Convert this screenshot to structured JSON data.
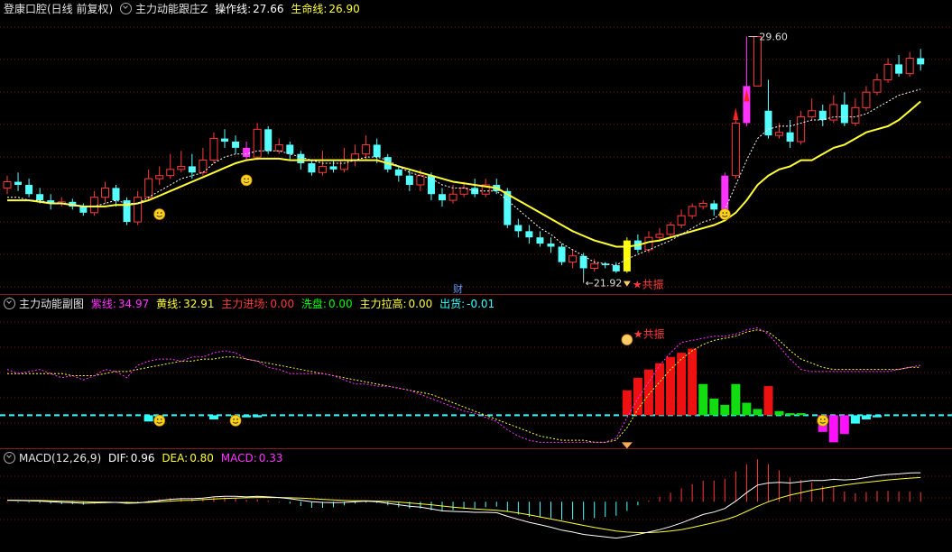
{
  "colors": {
    "bg": "#000000",
    "grid": "#7a1010",
    "up": "#ff3a3a",
    "down": "#55ffff",
    "yellow": "#ffff33",
    "white": "#ffffff",
    "magenta": "#ff33ff",
    "green": "#00ff00",
    "cyan": "#33ffff"
  },
  "panel1": {
    "title": "登康口腔(日线 前复权)",
    "indicator": "主力动能跟庄Z",
    "op_label": "操作线:",
    "op_value": "27.66",
    "life_label": "生命线:",
    "life_value": "26.90",
    "high_label": "29.60",
    "low_label": "21.92",
    "resonance_label": "★共振",
    "cai_label": "财"
  },
  "panel2": {
    "title": "主力动能副图",
    "purple_label": "紫线:",
    "purple_value": "34.97",
    "yellow_label": "黄线:",
    "yellow_value": "32.91",
    "enter_label": "主力进场:",
    "enter_value": "0.00",
    "wash_label": "洗盘:",
    "wash_value": "0.00",
    "pull_label": "主力拉高:",
    "pull_value": "0.00",
    "exit_label": "出货:",
    "exit_value": "-0.01",
    "resonance_label": "★共振"
  },
  "panel3": {
    "title": "MACD(12,26,9)",
    "dif_label": "DIF:",
    "dif_value": "0.96",
    "dea_label": "DEA:",
    "dea_value": "0.80",
    "macd_label": "MACD:",
    "macd_value": "0.33"
  },
  "chart_data": [
    {
      "type": "candlestick",
      "ylim": [
        21.5,
        30.2
      ],
      "candles": [
        [
          24.7,
          24.9,
          25.1,
          24.5
        ],
        [
          24.9,
          24.8,
          25.2,
          24.6
        ],
        [
          24.8,
          24.5,
          25.0,
          24.4
        ],
        [
          24.5,
          24.3,
          24.7,
          24.2
        ],
        [
          24.3,
          24.2,
          24.5,
          24.0
        ],
        [
          24.2,
          24.25,
          24.4,
          24.1
        ],
        [
          24.25,
          24.1,
          24.35,
          24.0
        ],
        [
          24.1,
          23.9,
          24.2,
          23.8
        ],
        [
          23.9,
          24.4,
          24.6,
          23.8
        ],
        [
          24.4,
          24.7,
          24.9,
          24.2
        ],
        [
          24.7,
          24.3,
          24.8,
          24.1
        ],
        [
          24.3,
          23.6,
          24.4,
          23.5
        ],
        [
          23.6,
          24.4,
          24.6,
          23.5
        ],
        [
          24.4,
          25.0,
          25.3,
          24.3
        ],
        [
          25.0,
          25.1,
          25.4,
          24.8
        ],
        [
          25.1,
          25.3,
          25.8,
          25.0
        ],
        [
          25.3,
          25.4,
          25.9,
          25.2
        ],
        [
          25.4,
          25.2,
          25.8,
          25.0
        ],
        [
          25.2,
          25.6,
          26.0,
          25.1
        ],
        [
          25.6,
          26.3,
          26.5,
          25.5
        ],
        [
          26.3,
          26.2,
          26.6,
          26.0
        ],
        [
          26.2,
          26.0,
          26.4,
          25.8
        ],
        [
          26.0,
          25.7,
          26.2,
          25.6
        ],
        [
          25.7,
          26.6,
          26.8,
          25.6
        ],
        [
          26.6,
          25.9,
          26.7,
          25.8
        ],
        [
          25.9,
          26.1,
          26.3,
          25.8
        ],
        [
          26.1,
          25.8,
          26.2,
          25.6
        ],
        [
          25.8,
          25.5,
          25.9,
          25.3
        ],
        [
          25.5,
          25.2,
          25.6,
          25.1
        ],
        [
          25.2,
          25.4,
          25.9,
          25.1
        ],
        [
          25.4,
          25.3,
          25.6,
          25.2
        ],
        [
          25.3,
          25.6,
          26.0,
          25.2
        ],
        [
          25.6,
          25.8,
          26.1,
          25.4
        ],
        [
          25.8,
          26.1,
          26.4,
          25.6
        ],
        [
          26.1,
          25.7,
          26.3,
          25.5
        ],
        [
          25.7,
          25.3,
          25.8,
          25.2
        ],
        [
          25.3,
          25.1,
          25.4,
          24.9
        ],
        [
          25.1,
          24.8,
          25.3,
          24.6
        ],
        [
          24.8,
          25.1,
          25.3,
          24.6
        ],
        [
          25.1,
          24.5,
          25.2,
          24.3
        ],
        [
          24.5,
          24.3,
          24.7,
          24.1
        ],
        [
          24.3,
          24.5,
          24.8,
          24.2
        ],
        [
          24.5,
          24.7,
          24.9,
          24.4
        ],
        [
          24.7,
          24.5,
          25.0,
          24.4
        ],
        [
          24.5,
          24.8,
          25.0,
          24.4
        ],
        [
          24.8,
          24.6,
          25.0,
          24.5
        ],
        [
          24.6,
          23.5,
          24.7,
          23.4
        ],
        [
          23.5,
          23.3,
          23.7,
          23.1
        ],
        [
          23.3,
          23.1,
          23.5,
          22.9
        ],
        [
          23.1,
          22.9,
          23.3,
          22.8
        ],
        [
          22.9,
          22.8,
          23.1,
          22.6
        ],
        [
          22.8,
          22.3,
          22.9,
          22.2
        ],
        [
          22.3,
          22.5,
          22.7,
          22.1
        ],
        [
          22.5,
          22.1,
          22.6,
          21.92
        ],
        [
          22.1,
          22.25,
          22.4,
          22.0
        ],
        [
          22.25,
          22.2,
          22.3,
          22.1
        ],
        [
          22.2,
          22.0,
          22.3,
          21.95
        ],
        [
          22.0,
          23.0,
          23.1,
          21.95
        ],
        [
          23.0,
          22.7,
          23.2,
          22.6
        ],
        [
          22.7,
          23.1,
          23.3,
          22.6
        ],
        [
          23.1,
          23.2,
          23.4,
          23.0
        ],
        [
          23.2,
          23.5,
          23.6,
          23.1
        ],
        [
          23.5,
          23.8,
          24.0,
          23.4
        ],
        [
          23.8,
          24.1,
          24.2,
          23.7
        ],
        [
          24.1,
          24.2,
          24.3,
          24.0
        ],
        [
          24.2,
          24.0,
          24.3,
          23.8
        ],
        [
          24.0,
          25.1,
          25.2,
          23.9
        ],
        [
          25.1,
          26.8,
          27.0,
          25.0
        ],
        [
          26.8,
          28.0,
          29.6,
          26.7
        ],
        [
          28.0,
          29.6,
          29.6,
          28.0
        ],
        [
          27.2,
          26.4,
          28.2,
          26.3
        ],
        [
          26.4,
          26.5,
          26.8,
          26.3
        ],
        [
          26.5,
          26.2,
          26.9,
          26.0
        ],
        [
          26.2,
          27.0,
          27.2,
          26.1
        ],
        [
          27.0,
          27.2,
          27.6,
          26.9
        ],
        [
          27.2,
          26.9,
          27.4,
          26.7
        ],
        [
          26.9,
          27.4,
          27.7,
          26.8
        ],
        [
          27.4,
          26.8,
          27.8,
          26.7
        ],
        [
          26.8,
          27.3,
          27.6,
          26.7
        ],
        [
          27.3,
          27.8,
          28.0,
          27.2
        ],
        [
          27.8,
          28.2,
          28.4,
          27.7
        ],
        [
          28.2,
          28.7,
          28.9,
          28.1
        ],
        [
          28.7,
          28.4,
          29.0,
          28.3
        ],
        [
          28.4,
          28.9,
          29.1,
          28.3
        ],
        [
          28.9,
          28.7,
          29.2,
          28.5
        ]
      ],
      "op_line": [
        24.4,
        24.4,
        24.3,
        24.3,
        24.2,
        24.2,
        24.15,
        24.1,
        24.1,
        24.2,
        24.3,
        24.2,
        24.2,
        24.4,
        24.6,
        24.8,
        25.0,
        25.1,
        25.2,
        25.5,
        25.7,
        25.8,
        25.8,
        25.9,
        25.9,
        25.9,
        25.8,
        25.7,
        25.6,
        25.5,
        25.5,
        25.5,
        25.6,
        25.7,
        25.7,
        25.6,
        25.4,
        25.2,
        25.1,
        25.0,
        24.8,
        24.7,
        24.7,
        24.6,
        24.6,
        24.6,
        24.3,
        24.0,
        23.7,
        23.4,
        23.2,
        22.9,
        22.7,
        22.5,
        22.3,
        22.25,
        22.2,
        22.4,
        22.55,
        22.7,
        22.85,
        23.0,
        23.2,
        23.4,
        23.6,
        23.7,
        24.0,
        24.8,
        25.6,
        26.3,
        26.6,
        26.7,
        26.7,
        26.8,
        26.9,
        26.9,
        27.0,
        27.0,
        27.0,
        27.1,
        27.3,
        27.5,
        27.7,
        27.8,
        27.9
      ],
      "life_line": [
        24.3,
        24.3,
        24.3,
        24.25,
        24.2,
        24.2,
        24.15,
        24.1,
        24.1,
        24.1,
        24.15,
        24.15,
        24.2,
        24.3,
        24.45,
        24.6,
        24.75,
        24.9,
        25.05,
        25.2,
        25.35,
        25.5,
        25.6,
        25.65,
        25.65,
        25.65,
        25.6,
        25.6,
        25.6,
        25.6,
        25.6,
        25.6,
        25.6,
        25.6,
        25.6,
        25.5,
        25.4,
        25.3,
        25.2,
        25.1,
        25.0,
        24.9,
        24.85,
        24.8,
        24.75,
        24.7,
        24.5,
        24.3,
        24.1,
        23.9,
        23.7,
        23.5,
        23.3,
        23.15,
        23.0,
        22.9,
        22.8,
        22.8,
        22.85,
        22.95,
        23.0,
        23.1,
        23.2,
        23.3,
        23.4,
        23.5,
        23.65,
        23.9,
        24.3,
        24.8,
        25.1,
        25.3,
        25.4,
        25.6,
        25.6,
        25.8,
        26.0,
        26.1,
        26.3,
        26.5,
        26.6,
        26.7,
        26.9,
        27.2,
        27.5
      ]
    },
    {
      "type": "line+bar",
      "ylim": [
        -15,
        50
      ],
      "purple": [
        22,
        20,
        21,
        22,
        20,
        18,
        19,
        17,
        19,
        22,
        21,
        18,
        24,
        26,
        27,
        27,
        26,
        28,
        28,
        30,
        31,
        30,
        27,
        26,
        23,
        22,
        20,
        20,
        20,
        20,
        19,
        17,
        15,
        15,
        14,
        14,
        13,
        12,
        10,
        8,
        6,
        4,
        2,
        1,
        -1,
        -3,
        -7,
        -10,
        -12,
        -13,
        -13,
        -13,
        -13,
        -13,
        -13,
        -13,
        -11,
        -1,
        8,
        16,
        24,
        30,
        35,
        36,
        37,
        38,
        38,
        39,
        41,
        42,
        39,
        33,
        27,
        22,
        21,
        21,
        21,
        21,
        21,
        21,
        21,
        21,
        22,
        23,
        24
      ],
      "yellow": [
        20,
        20,
        20,
        20,
        20,
        20,
        19,
        19,
        19,
        20,
        21,
        21,
        22,
        23,
        24,
        25,
        26,
        26,
        27,
        27,
        28,
        28,
        27,
        26,
        25,
        24,
        23,
        22,
        21,
        20,
        19,
        18,
        17,
        16,
        15,
        14,
        13,
        12,
        11,
        10,
        8,
        6,
        4,
        2,
        0,
        -2,
        -4,
        -6,
        -8,
        -10,
        -11,
        -12,
        -12,
        -12,
        -13,
        -13,
        -12,
        -6,
        3,
        10,
        16,
        22,
        27,
        31,
        34,
        36,
        37,
        38,
        40,
        41,
        40,
        36,
        31,
        27,
        25,
        23,
        22,
        22,
        22,
        22,
        22,
        22,
        22,
        23,
        23
      ],
      "red_bars": [
        [
          57,
          12
        ],
        [
          58,
          18
        ],
        [
          59,
          22
        ],
        [
          60,
          25
        ],
        [
          61,
          28
        ],
        [
          62,
          30
        ],
        [
          63,
          32
        ],
        [
          70,
          14
        ]
      ],
      "green_bars": [
        [
          64,
          15
        ],
        [
          65,
          8
        ],
        [
          66,
          5
        ],
        [
          67,
          15
        ],
        [
          68,
          6
        ],
        [
          69,
          3
        ],
        [
          71,
          2
        ],
        [
          72,
          1
        ],
        [
          73,
          1
        ]
      ],
      "magenta_bars": [
        [
          75,
          -8
        ],
        [
          76,
          -13
        ],
        [
          77,
          -9
        ]
      ],
      "cyan_bars": [
        [
          13,
          -3
        ],
        [
          14,
          -2
        ],
        [
          19,
          -2
        ],
        [
          21,
          -2
        ],
        [
          22,
          -1
        ],
        [
          23,
          -1
        ],
        [
          78,
          -4
        ],
        [
          79,
          -2
        ],
        [
          80,
          -1
        ]
      ]
    },
    {
      "type": "line+bar",
      "ylim": [
        -1.6,
        1.2
      ],
      "dif": [
        0.05,
        0.04,
        0.03,
        0.02,
        0.0,
        -0.02,
        -0.03,
        -0.05,
        -0.04,
        -0.03,
        -0.02,
        -0.05,
        -0.04,
        0.0,
        0.04,
        0.08,
        0.1,
        0.1,
        0.12,
        0.16,
        0.18,
        0.18,
        0.16,
        0.18,
        0.16,
        0.14,
        0.1,
        0.05,
        0.0,
        -0.02,
        -0.03,
        -0.02,
        0.0,
        0.02,
        0.0,
        -0.05,
        -0.1,
        -0.15,
        -0.18,
        -0.24,
        -0.3,
        -0.32,
        -0.33,
        -0.35,
        -0.35,
        -0.36,
        -0.48,
        -0.58,
        -0.68,
        -0.76,
        -0.84,
        -0.94,
        -1.0,
        -1.08,
        -1.12,
        -1.16,
        -1.2,
        -1.15,
        -1.08,
        -1.0,
        -0.92,
        -0.82,
        -0.7,
        -0.56,
        -0.42,
        -0.34,
        -0.22,
        0.02,
        0.3,
        0.55,
        0.62,
        0.64,
        0.62,
        0.66,
        0.7,
        0.7,
        0.74,
        0.72,
        0.74,
        0.8,
        0.86,
        0.9,
        0.92,
        0.95,
        0.96
      ],
      "dea": [
        0.05,
        0.05,
        0.04,
        0.04,
        0.03,
        0.02,
        0.01,
        0.0,
        -0.01,
        -0.01,
        -0.02,
        -0.02,
        -0.03,
        -0.02,
        0.0,
        0.02,
        0.04,
        0.05,
        0.07,
        0.09,
        0.11,
        0.12,
        0.13,
        0.14,
        0.14,
        0.14,
        0.13,
        0.12,
        0.1,
        0.08,
        0.06,
        0.04,
        0.03,
        0.03,
        0.02,
        0.01,
        -0.01,
        -0.04,
        -0.07,
        -0.1,
        -0.14,
        -0.18,
        -0.21,
        -0.24,
        -0.26,
        -0.28,
        -0.32,
        -0.37,
        -0.43,
        -0.5,
        -0.57,
        -0.64,
        -0.71,
        -0.78,
        -0.85,
        -0.91,
        -0.97,
        -1.0,
        -1.02,
        -1.02,
        -1.0,
        -0.97,
        -0.92,
        -0.85,
        -0.77,
        -0.69,
        -0.6,
        -0.48,
        -0.32,
        -0.15,
        0.0,
        0.12,
        0.22,
        0.3,
        0.38,
        0.44,
        0.5,
        0.55,
        0.6,
        0.64,
        0.68,
        0.72,
        0.75,
        0.78,
        0.8
      ],
      "dif_value": "0.96"
    }
  ]
}
